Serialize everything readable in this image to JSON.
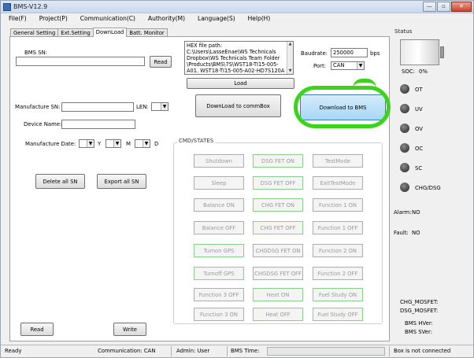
{
  "window": {
    "title": "BMS-V12.9",
    "buttons": [
      "—",
      "▫",
      "✕"
    ]
  },
  "menu": [
    "File(F)",
    "Project(P)",
    "Communication(C)",
    "Authority(M)",
    "Language(S)",
    "Help(H)"
  ],
  "tabs": [
    "General Setting",
    "Ext.Setting",
    "DownLoad",
    "Batt. Monitor"
  ],
  "active_tab": "DownLoad",
  "left": {
    "bms_sn_label": "BMS SN:",
    "bms_sn_value": "",
    "read_label": "Read",
    "manufacture_sn_label": "Manufacture SN:",
    "manufacture_sn_value": "",
    "len_label": "LEN:",
    "len_value": "",
    "device_name_label": "Device Name:",
    "device_name_value": "",
    "manufacture_date_label": "Manufacture Date:",
    "date_y": "Y",
    "date_m": "M",
    "date_d": "D",
    "delete_all_sn": "Delete all SN",
    "export_all_sn": "Export all SN",
    "bottom_read": "Read",
    "bottom_write": "Write"
  },
  "download": {
    "hex_path": "HEX file path:\nC:\\Users\\LasseEnae\\WS Technicals\nDropbox\\WS Technicals Team Folder\n\\Products\\BMS\\7S\\WST18-TI15-005-\nA01. WST18-TI15-005-A02-HD7S120A",
    "load_label": "Load",
    "baudrate_label": "Baudrate:",
    "baudrate_value": "250000",
    "bps": "bps",
    "port_label": "Port:",
    "port_value": "CAN",
    "download_commbox": "DownLoad to commBox",
    "download_bms": "Download to BMS",
    "highlight_color": "#3cd41b"
  },
  "cmd": {
    "title": "CMD/STATES",
    "buttons": [
      [
        "Shutdown",
        "DSG FET ON",
        "TestMode"
      ],
      [
        "Sleep",
        "DSG FET OFF",
        "ExitTestMode"
      ],
      [
        "Balance ON",
        "CHG FET ON",
        "Function 1  ON"
      ],
      [
        "Balance OFF",
        "CHG FET OFF",
        "Function 1  OFF"
      ],
      [
        "Turnon GPS",
        "CHGDSG FET ON",
        "Function 2  ON"
      ],
      [
        "Turnoff GPS",
        "CHGDSG FET OFF",
        "Function 2  OFF"
      ],
      [
        "Function 3  OFF",
        "Heat ON",
        "Fuel Study ON"
      ],
      [
        "Function 3  ON",
        "Heat OFF",
        "Fuel Study OFF"
      ]
    ]
  },
  "status": {
    "title": "Status",
    "soc_label": "SOC:",
    "soc_value": "0%",
    "indicators": [
      "OT",
      "UV",
      "OV",
      "OC",
      "SC",
      "CHG/DSG"
    ],
    "alarm_label": "Alarm:",
    "alarm_value": "NO",
    "fault_label": "Fault:",
    "fault_value": "NO",
    "chg_mosfet": "CHG_MOSFET:",
    "dsg_mosfet": "DSG_MOSFET:",
    "bms_hver": "BMS HVer:",
    "bms_sver": "BMS SVer:"
  },
  "statusbar": {
    "ready": "Ready",
    "communication": "Communication:  CAN",
    "admin": "Admin:  User",
    "bms_time": "BMS Time:",
    "box_status": "Box is not connected"
  }
}
